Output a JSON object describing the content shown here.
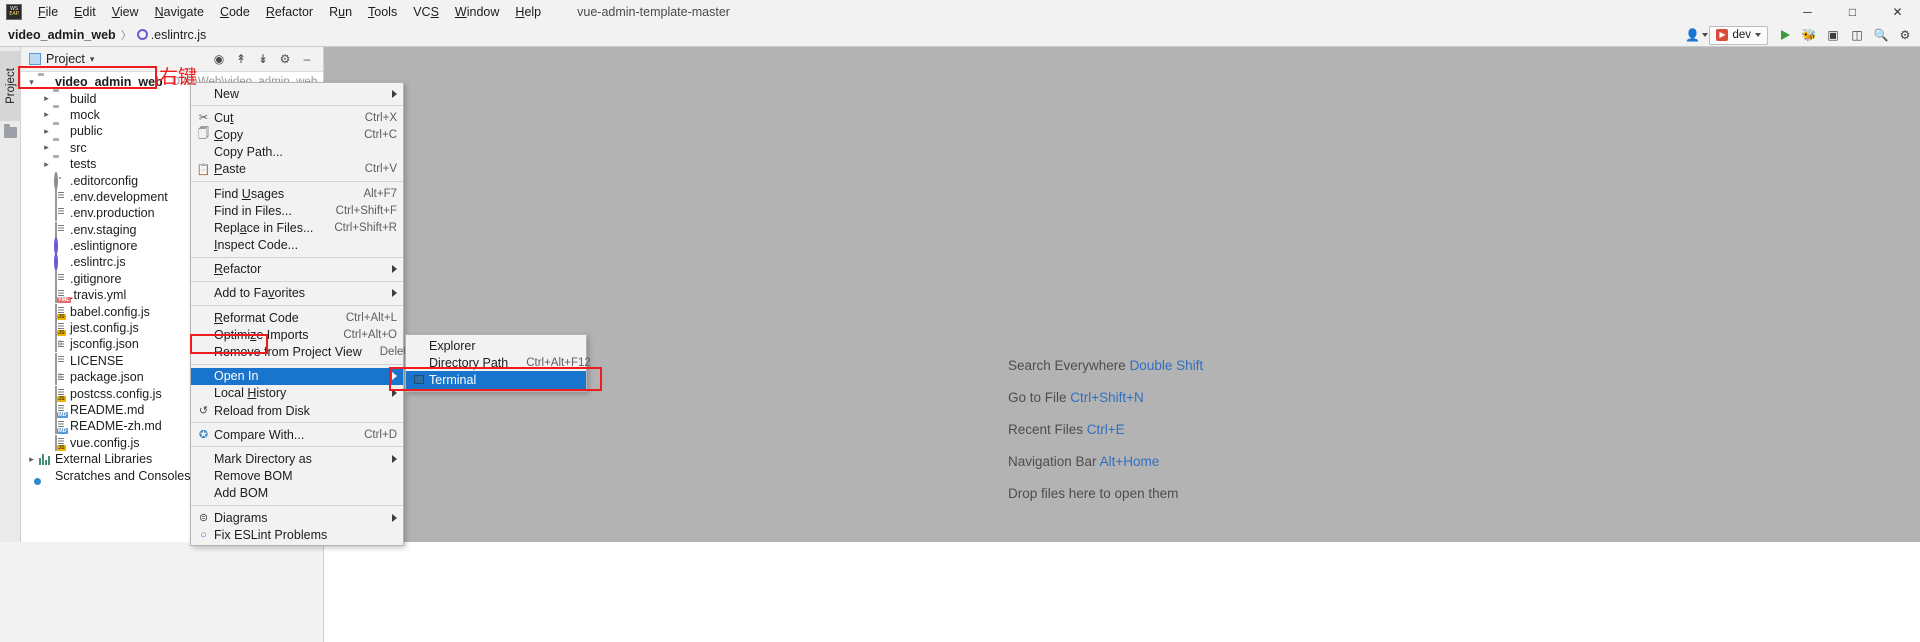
{
  "window": {
    "title": "vue-admin-template-master",
    "logo_top": "WS",
    "logo_bottom": "EAP",
    "minimize": "─",
    "maximize": "□",
    "close": "✕"
  },
  "menubar": {
    "items": [
      {
        "label": "File",
        "accel": "F"
      },
      {
        "label": "Edit",
        "accel": "E"
      },
      {
        "label": "View",
        "accel": "V"
      },
      {
        "label": "Navigate",
        "accel": "N"
      },
      {
        "label": "Code",
        "accel": "C"
      },
      {
        "label": "Refactor",
        "accel": "R"
      },
      {
        "label": "Run",
        "accel": "u"
      },
      {
        "label": "Tools",
        "accel": "T"
      },
      {
        "label": "VCS",
        "accel": "S"
      },
      {
        "label": "Window",
        "accel": "W"
      },
      {
        "label": "Help",
        "accel": "H"
      }
    ]
  },
  "breadcrumb": {
    "project": "video_admin_web",
    "separator": "〉",
    "file": ".eslintrc.js"
  },
  "toolbar": {
    "run_config": "dev",
    "run_icon": "run-icon",
    "debug_icon": "debug-icon",
    "stop_icon": "stop-icon",
    "layout_icon": "layout-icon",
    "search_icon": "search-icon",
    "settings_icon": "settings-icon",
    "user_icon": "user-icon"
  },
  "tool_window": {
    "vertical_tab": "Project",
    "title": "Project",
    "dropdown_arrow": "▾",
    "actions": [
      "locate-icon",
      "collapse-all-icon",
      "expand-all-icon",
      "settings-icon",
      "hide-icon"
    ]
  },
  "tree": {
    "root": {
      "label": "video_admin_web",
      "path": "D:\\D\\Web\\video_admin_web",
      "expanded": true
    },
    "items": [
      {
        "label": "build",
        "icon": "folder",
        "expandable": true,
        "indent": 1
      },
      {
        "label": "mock",
        "icon": "folder",
        "expandable": true,
        "indent": 1
      },
      {
        "label": "public",
        "icon": "folder",
        "expandable": true,
        "indent": 1
      },
      {
        "label": "src",
        "icon": "folder",
        "expandable": true,
        "indent": 1
      },
      {
        "label": "tests",
        "icon": "folder",
        "expandable": true,
        "indent": 1
      },
      {
        "label": ".editorconfig",
        "icon": "gear",
        "expandable": false,
        "indent": 1
      },
      {
        "label": ".env.development",
        "icon": "file",
        "expandable": false,
        "indent": 1
      },
      {
        "label": ".env.production",
        "icon": "file",
        "expandable": false,
        "indent": 1
      },
      {
        "label": ".env.staging",
        "icon": "file",
        "expandable": false,
        "indent": 1
      },
      {
        "label": ".eslintignore",
        "icon": "eslint",
        "expandable": false,
        "indent": 1
      },
      {
        "label": ".eslintrc.js",
        "icon": "eslint",
        "expandable": false,
        "indent": 1
      },
      {
        "label": ".gitignore",
        "icon": "ignore",
        "expandable": false,
        "indent": 1
      },
      {
        "label": ".travis.yml",
        "icon": "yml",
        "expandable": false,
        "indent": 1
      },
      {
        "label": "babel.config.js",
        "icon": "js",
        "expandable": false,
        "indent": 1
      },
      {
        "label": "jest.config.js",
        "icon": "js",
        "expandable": false,
        "indent": 1
      },
      {
        "label": "jsconfig.json",
        "icon": "json",
        "expandable": false,
        "indent": 1
      },
      {
        "label": "LICENSE",
        "icon": "file",
        "expandable": false,
        "indent": 1
      },
      {
        "label": "package.json",
        "icon": "json",
        "expandable": false,
        "indent": 1
      },
      {
        "label": "postcss.config.js",
        "icon": "js",
        "expandable": false,
        "indent": 1
      },
      {
        "label": "README.md",
        "icon": "md",
        "expandable": false,
        "indent": 1
      },
      {
        "label": "README-zh.md",
        "icon": "md",
        "expandable": false,
        "indent": 1
      },
      {
        "label": "vue.config.js",
        "icon": "js",
        "expandable": false,
        "indent": 1
      },
      {
        "label": "External Libraries",
        "icon": "lib",
        "expandable": true,
        "indent": 0
      },
      {
        "label": "Scratches and Consoles",
        "icon": "scratch",
        "expandable": false,
        "indent": 0
      }
    ]
  },
  "context_menu": {
    "items": [
      {
        "label": "New",
        "icon": "",
        "shortcut": "",
        "submenu": true,
        "selected": false,
        "accel": ""
      },
      {
        "sep": true
      },
      {
        "label": "Cut",
        "icon": "cut-icon",
        "shortcut": "Ctrl+X",
        "submenu": false,
        "selected": false,
        "accel": "t"
      },
      {
        "label": "Copy",
        "icon": "copy-icon",
        "shortcut": "Ctrl+C",
        "submenu": false,
        "selected": false,
        "accel": "C"
      },
      {
        "label": "Copy Path...",
        "icon": "",
        "shortcut": "",
        "submenu": false,
        "selected": false,
        "accel": ""
      },
      {
        "label": "Paste",
        "icon": "paste-icon",
        "shortcut": "Ctrl+V",
        "submenu": false,
        "selected": false,
        "accel": "P"
      },
      {
        "sep": true
      },
      {
        "label": "Find Usages",
        "icon": "",
        "shortcut": "Alt+F7",
        "submenu": false,
        "selected": false,
        "accel": "U"
      },
      {
        "label": "Find in Files...",
        "icon": "",
        "shortcut": "Ctrl+Shift+F",
        "submenu": false,
        "selected": false,
        "accel": ""
      },
      {
        "label": "Replace in Files...",
        "icon": "",
        "shortcut": "Ctrl+Shift+R",
        "submenu": false,
        "selected": false,
        "accel": "a"
      },
      {
        "label": "Inspect Code...",
        "icon": "",
        "shortcut": "",
        "submenu": false,
        "selected": false,
        "accel": "I"
      },
      {
        "sep": true
      },
      {
        "label": "Refactor",
        "icon": "",
        "shortcut": "",
        "submenu": true,
        "selected": false,
        "accel": "R"
      },
      {
        "sep": true
      },
      {
        "label": "Add to Favorites",
        "icon": "",
        "shortcut": "",
        "submenu": true,
        "selected": false,
        "accel": "v"
      },
      {
        "sep": true
      },
      {
        "label": "Reformat Code",
        "icon": "",
        "shortcut": "Ctrl+Alt+L",
        "submenu": false,
        "selected": false,
        "accel": "R"
      },
      {
        "label": "Optimize Imports",
        "icon": "",
        "shortcut": "Ctrl+Alt+O",
        "submenu": false,
        "selected": false,
        "accel": "z"
      },
      {
        "label": "Remove from Project View",
        "icon": "",
        "shortcut": "Delete",
        "submenu": false,
        "selected": false,
        "accel": ""
      },
      {
        "sep": true
      },
      {
        "label": "Open In",
        "icon": "",
        "shortcut": "",
        "submenu": true,
        "selected": true,
        "accel": ""
      },
      {
        "label": "Local History",
        "icon": "",
        "shortcut": "",
        "submenu": true,
        "selected": false,
        "accel": "H"
      },
      {
        "label": "Reload from Disk",
        "icon": "reload-icon",
        "shortcut": "",
        "submenu": false,
        "selected": false,
        "accel": ""
      },
      {
        "sep": true
      },
      {
        "label": "Compare With...",
        "icon": "compare-icon",
        "shortcut": "Ctrl+D",
        "submenu": false,
        "selected": false,
        "accel": ""
      },
      {
        "sep": true
      },
      {
        "label": "Mark Directory as",
        "icon": "",
        "shortcut": "",
        "submenu": true,
        "selected": false,
        "accel": ""
      },
      {
        "label": "Remove BOM",
        "icon": "",
        "shortcut": "",
        "submenu": false,
        "selected": false,
        "accel": ""
      },
      {
        "label": "Add BOM",
        "icon": "",
        "shortcut": "",
        "submenu": false,
        "selected": false,
        "accel": ""
      },
      {
        "sep": true
      },
      {
        "label": "Diagrams",
        "icon": "diagram-icon",
        "shortcut": "",
        "submenu": true,
        "selected": false,
        "accel": ""
      },
      {
        "label": "Fix ESLint Problems",
        "icon": "eslint-icon",
        "shortcut": "",
        "submenu": false,
        "selected": false,
        "accel": ""
      }
    ]
  },
  "open_in_submenu": {
    "items": [
      {
        "label": "Explorer",
        "shortcut": "",
        "selected": false
      },
      {
        "label": "Directory Path",
        "shortcut": "Ctrl+Alt+F12",
        "selected": false
      },
      {
        "label": "Terminal",
        "shortcut": "",
        "selected": true
      }
    ]
  },
  "editor_hints": {
    "rows": [
      {
        "text": "Search Everywhere ",
        "key": "Double Shift"
      },
      {
        "text": "Go to File ",
        "key": "Ctrl+Shift+N"
      },
      {
        "text": "Recent Files ",
        "key": "Ctrl+E"
      },
      {
        "text": "Navigation Bar ",
        "key": "Alt+Home"
      },
      {
        "text": "Drop files here to open them",
        "key": ""
      }
    ]
  },
  "annotations": {
    "right_click_label": "右键",
    "accent_color": "#ee1c1c",
    "selection_color": "#1874cd"
  }
}
